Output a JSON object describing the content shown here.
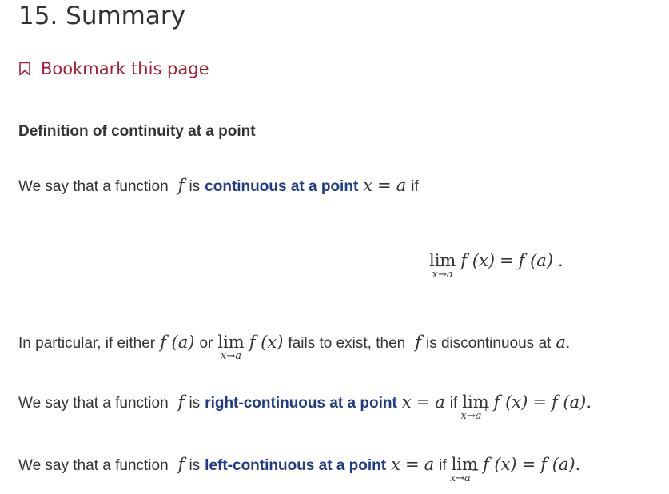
{
  "page": {
    "title": "15. Summary",
    "bookmark_label": "Bookmark this page",
    "section_heading": "Definition of continuity at a point"
  },
  "para1": {
    "prefix": "We say that a function",
    "f": "f",
    "is": "is",
    "term": "continuous at a point",
    "cond_var": "x",
    "eq": "=",
    "cond_val": "a",
    "suffix": "if"
  },
  "display_eq": {
    "lim": "lim",
    "sub": "x→a",
    "lhs": "f (x)",
    "eq": "=",
    "rhs": "f (a)",
    "end": "."
  },
  "para2": {
    "prefix": "In particular, if either",
    "fa": "f (a)",
    "or": "or",
    "lim": "lim",
    "sub": "x→a",
    "fx": "f (x)",
    "mid": "fails to exist, then",
    "f": "f",
    "suffix": "is discontinuous at",
    "a": "a",
    "end": "."
  },
  "para3": {
    "prefix": "We say that a function",
    "f": "f",
    "is": "is",
    "term": "right-continuous at a point",
    "cond_var": "x",
    "eq": "=",
    "cond_val": "a",
    "if": "if",
    "lim": "lim",
    "sub": "x→a",
    "sup": "+",
    "lhs": "f (x)",
    "eq2": "=",
    "rhs": "f (a)",
    "end": "."
  },
  "para4": {
    "prefix": "We say that a function",
    "f": "f",
    "is": "is",
    "term": "left-continuous at a point",
    "cond_var": "x",
    "eq": "=",
    "cond_val": "a",
    "if": "if",
    "lim": "lim",
    "sub": "x→a",
    "sup": "−",
    "lhs": "f (x)",
    "eq2": "=",
    "rhs": "f (a)",
    "end": "."
  },
  "colors": {
    "accent": "#a31f34",
    "term": "#1f3b87",
    "text": "#333333"
  },
  "icons": {
    "bookmark": "bookmark-outline-icon"
  }
}
